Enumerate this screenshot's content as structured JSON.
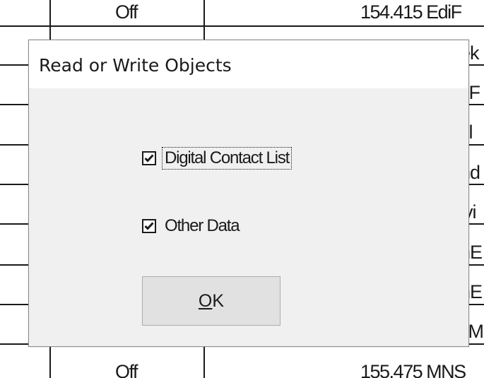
{
  "background_table": {
    "top_cells": [
      "Off",
      "154.415 EdiF"
    ],
    "bottom_cells": [
      "Off",
      "155.475 MNS"
    ],
    "right_column_fragments": [
      "ek",
      "kF",
      "sl",
      "nd",
      "ivi",
      "nE",
      "nE",
      "lIM"
    ]
  },
  "dialog": {
    "title": "Read or Write Objects",
    "checkboxes": [
      {
        "label": "Digital Contact List",
        "checked": true,
        "focused": true
      },
      {
        "label": "Other Data",
        "checked": true,
        "focused": false
      }
    ],
    "ok_button": {
      "mnemonic": "O",
      "rest": "K"
    }
  }
}
